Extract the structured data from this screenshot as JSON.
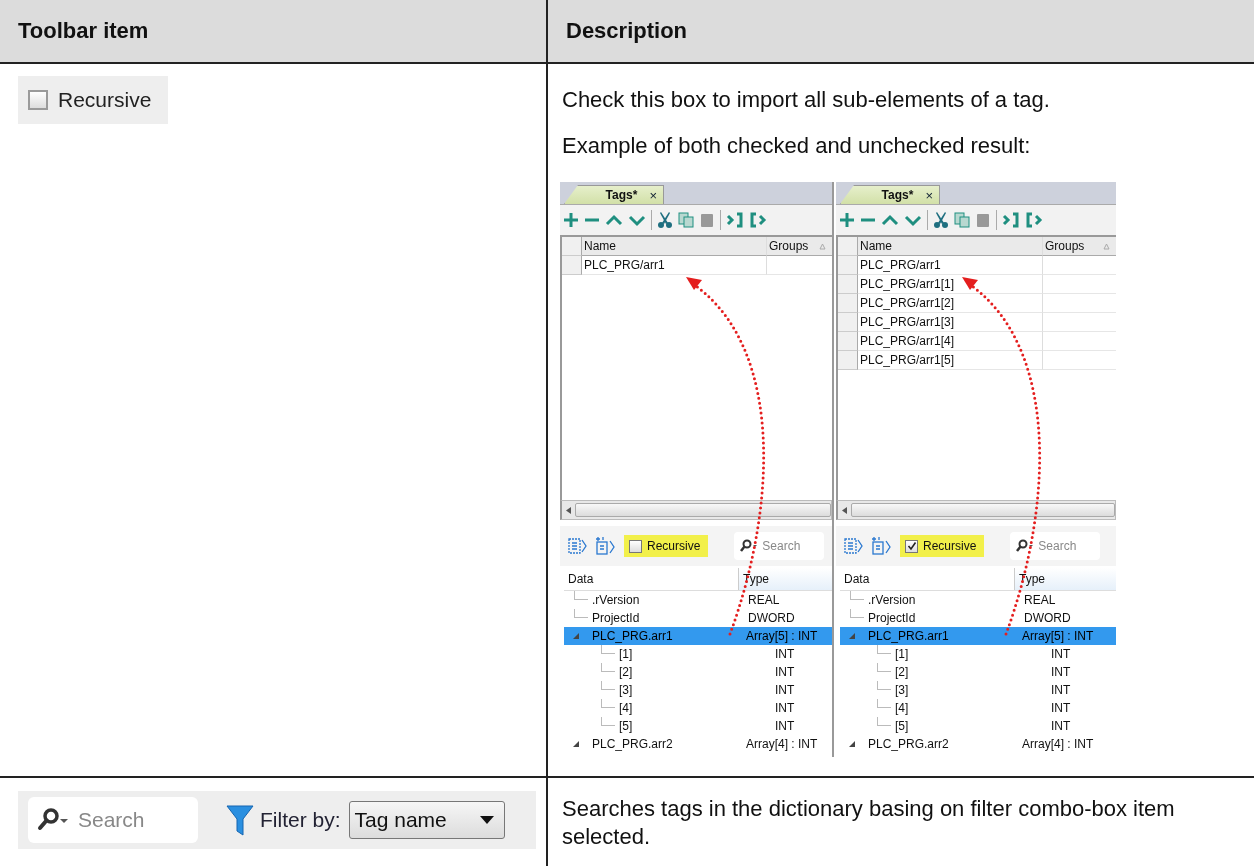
{
  "table": {
    "columns": [
      "Toolbar item",
      "Description"
    ],
    "rows": [
      {
        "item": {
          "kind": "checkbox",
          "label": "Recursive",
          "checked": false
        },
        "description": [
          "Check this box to import all sub-elements of a tag.",
          "Example of both checked and unchecked result:"
        ],
        "examples": [
          {
            "tab": {
              "label": "Tags*",
              "close": "×"
            },
            "grid": {
              "columns": [
                "Name",
                "Groups"
              ],
              "rows": [
                "PLC_PRG/arr1"
              ]
            },
            "recursive": {
              "label": "Recursive",
              "checked": false
            },
            "search": {
              "placeholder": "Search"
            },
            "tree": {
              "columns": [
                "Data",
                "Type"
              ],
              "items": [
                {
                  "name": ".rVersion",
                  "type": "REAL",
                  "selected": false
                },
                {
                  "name": "ProjectId",
                  "type": "DWORD",
                  "selected": false
                },
                {
                  "name": "PLC_PRG.arr1",
                  "type": "Array[5] : INT",
                  "selected": true,
                  "expanded": true,
                  "children": [
                    {
                      "name": "[1]",
                      "type": "INT",
                      "selected": false
                    },
                    {
                      "name": "[2]",
                      "type": "INT",
                      "selected": false
                    },
                    {
                      "name": "[3]",
                      "type": "INT",
                      "selected": false
                    },
                    {
                      "name": "[4]",
                      "type": "INT",
                      "selected": false
                    },
                    {
                      "name": "[5]",
                      "type": "INT",
                      "selected": false
                    }
                  ]
                },
                {
                  "name": "PLC_PRG.arr2",
                  "type": "Array[4] : INT",
                  "selected": false,
                  "expanded": true
                }
              ]
            }
          },
          {
            "tab": {
              "label": "Tags*",
              "close": "×"
            },
            "grid": {
              "columns": [
                "Name",
                "Groups"
              ],
              "rows": [
                "PLC_PRG/arr1",
                "PLC_PRG/arr1[1]",
                "PLC_PRG/arr1[2]",
                "PLC_PRG/arr1[3]",
                "PLC_PRG/arr1[4]",
                "PLC_PRG/arr1[5]"
              ]
            },
            "recursive": {
              "label": "Recursive",
              "checked": true
            },
            "search": {
              "placeholder": "Search"
            },
            "tree": {
              "columns": [
                "Data",
                "Type"
              ],
              "items": [
                {
                  "name": ".rVersion",
                  "type": "REAL",
                  "selected": false
                },
                {
                  "name": "ProjectId",
                  "type": "DWORD",
                  "selected": false
                },
                {
                  "name": "PLC_PRG.arr1",
                  "type": "Array[5] : INT",
                  "selected": true,
                  "expanded": true,
                  "children": [
                    {
                      "name": "[1]",
                      "type": "INT",
                      "selected": false
                    },
                    {
                      "name": "[2]",
                      "type": "INT",
                      "selected": false
                    },
                    {
                      "name": "[3]",
                      "type": "INT",
                      "selected": false
                    },
                    {
                      "name": "[4]",
                      "type": "INT",
                      "selected": false
                    },
                    {
                      "name": "[5]",
                      "type": "INT",
                      "selected": false
                    }
                  ]
                },
                {
                  "name": "PLC_PRG.arr2",
                  "type": "Array[4] : INT",
                  "selected": false,
                  "expanded": true
                }
              ]
            }
          }
        ]
      },
      {
        "item": {
          "kind": "search_filter",
          "search": {
            "placeholder": "Search"
          },
          "filter_label": "Filter by:",
          "filter_value": "Tag name"
        },
        "description": [
          "Searches tags in the dictionary basing on filter combo-box item selected."
        ]
      }
    ]
  }
}
